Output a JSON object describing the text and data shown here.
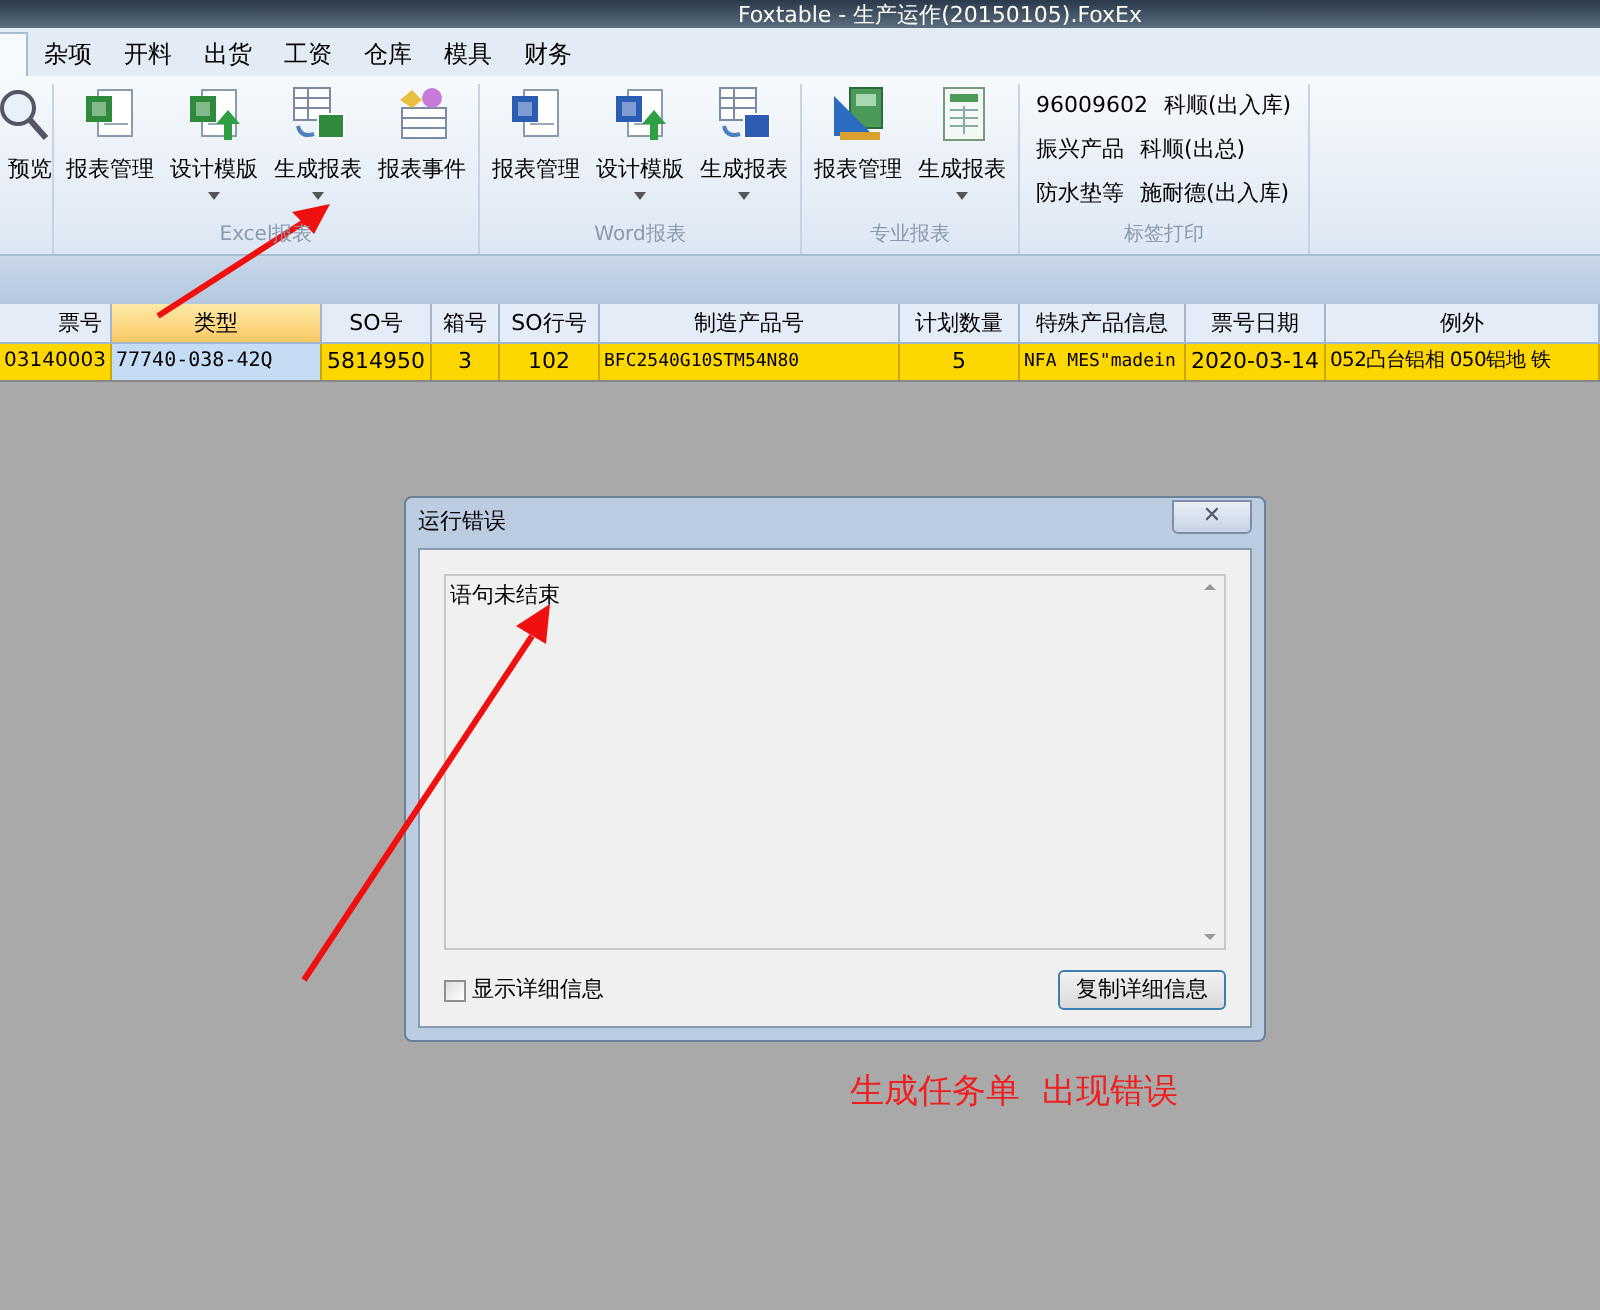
{
  "window": {
    "title": "Foxtable - 生产运作(20150105).FoxEx"
  },
  "tabs": [
    {
      "label": "杂项",
      "selected": false
    },
    {
      "label": "开料",
      "selected": false
    },
    {
      "label": "出货",
      "selected": false
    },
    {
      "label": "工资",
      "selected": false
    },
    {
      "label": "仓库",
      "selected": false
    },
    {
      "label": "模具",
      "selected": false
    },
    {
      "label": "财务",
      "selected": false
    }
  ],
  "ribbon": {
    "groups": [
      {
        "items": [
          {
            "label": "预览",
            "kind": "magnifier",
            "dropdown": false
          }
        ]
      },
      {
        "title": "Excel报表",
        "items": [
          {
            "label": "报表管理",
            "kind": "excel-doc",
            "dropdown": false
          },
          {
            "label": "设计模版",
            "kind": "excel-upload",
            "dropdown": true
          },
          {
            "label": "生成报表",
            "kind": "table-excel",
            "dropdown": true
          },
          {
            "label": "报表事件",
            "kind": "event",
            "dropdown": false
          }
        ]
      },
      {
        "title": "Word报表",
        "items": [
          {
            "label": "报表管理",
            "kind": "word-doc",
            "dropdown": false
          },
          {
            "label": "设计模版",
            "kind": "word-upload",
            "dropdown": true
          },
          {
            "label": "生成报表",
            "kind": "table-word",
            "dropdown": true
          }
        ]
      },
      {
        "title": "专业报表",
        "items": [
          {
            "label": "报表管理",
            "kind": "ruler-book",
            "dropdown": false
          },
          {
            "label": "生成报表",
            "kind": "sheet",
            "dropdown": true
          }
        ]
      },
      {
        "title": "标签打印",
        "links": [
          [
            "96009602",
            "科顺(出入库)"
          ],
          [
            "振兴产品",
            "科顺(出总)"
          ],
          [
            "防水垫等",
            "施耐德(出入库)"
          ]
        ]
      }
    ]
  },
  "table": {
    "columns": [
      {
        "label": "票号",
        "selected": false
      },
      {
        "label": "类型",
        "selected": true
      },
      {
        "label": "SO号",
        "selected": false
      },
      {
        "label": "箱号",
        "selected": false
      },
      {
        "label": "SO行号",
        "selected": false
      },
      {
        "label": "制造产品号",
        "selected": false
      },
      {
        "label": "计划数量",
        "selected": false
      },
      {
        "label": "特殊产品信息",
        "selected": false
      },
      {
        "label": "票号日期",
        "selected": false
      },
      {
        "label": "例外",
        "selected": false
      }
    ],
    "rows": [
      {
        "cells": [
          "03140003",
          "77740-038-42Q",
          "5814950",
          "3",
          "102",
          "BFC2540G10STM54N80",
          "5",
          "NFA MES\"madein",
          "2020-03-14",
          "052凸台铝相 050铝地 铁"
        ]
      }
    ]
  },
  "dialog": {
    "title": "运行错误",
    "close": "✕",
    "message": "语句未结束",
    "checkbox": {
      "label": "显示详细信息",
      "checked": false
    },
    "button": "复制详细信息"
  },
  "annotation": {
    "text": "生成任务单  出现错误"
  }
}
